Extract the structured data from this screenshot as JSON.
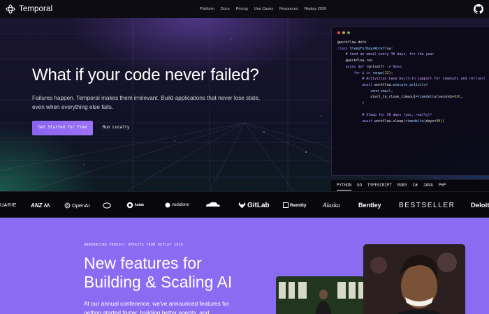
{
  "nav": {
    "brand": "Temporal",
    "links": [
      "Platform",
      "Docs",
      "Pricing",
      "Use Cases",
      "Resources",
      "Replay 2026"
    ]
  },
  "hero": {
    "title": "What if your code never failed?",
    "subtitle": "Failures happen. Temporal makes them irrelevant. Build applications that never lose state, even when everything else fails.",
    "primary_cta": "Get Started for Free",
    "secondary_cta": "Run Locally"
  },
  "code": {
    "lines": [
      "@workflow.defn",
      "class SleepForDaysWorkflow:",
      "    # Send an email every 30 days, for the year",
      "    @workflow.run",
      "    async def run(self) -> None:",
      "        for i in range(12):",
      "            # Activities have built-in support for timeouts and retries!",
      "            await workflow.execute_activity(",
      "                send_email,",
      "                start_to_close_timeout=timedelta(seconds=10),",
      "            )",
      "",
      "            # Sleep for 30 days (yes, really)!",
      "            await workflow.sleep(timedelta(days=30))"
    ],
    "tabs": [
      "PYTHON",
      "GO",
      "TYPESCRIPT",
      "RUBY",
      "C#",
      "JAVA",
      "PHP"
    ],
    "active_tab": "PYTHON"
  },
  "logos": [
    "UARIE",
    "ANZ",
    "OpenAI",
    "kotak",
    "vodafone",
    "GitLab",
    "Remitly",
    "Alaska",
    "Bentley",
    "BESTSELLER",
    "Deloitte"
  ],
  "announce": {
    "eyebrow": "ANNOUNCING PRODUCT UPDATES FROM REPLAY 2026",
    "title_line1": "New features for",
    "title_line2": "Building & Scaling AI",
    "body": "At our annual conference, we've announced features for getting started faster, building better agents, and"
  },
  "colors": {
    "accent": "#8c6bf3",
    "button": "#8a63f2"
  }
}
